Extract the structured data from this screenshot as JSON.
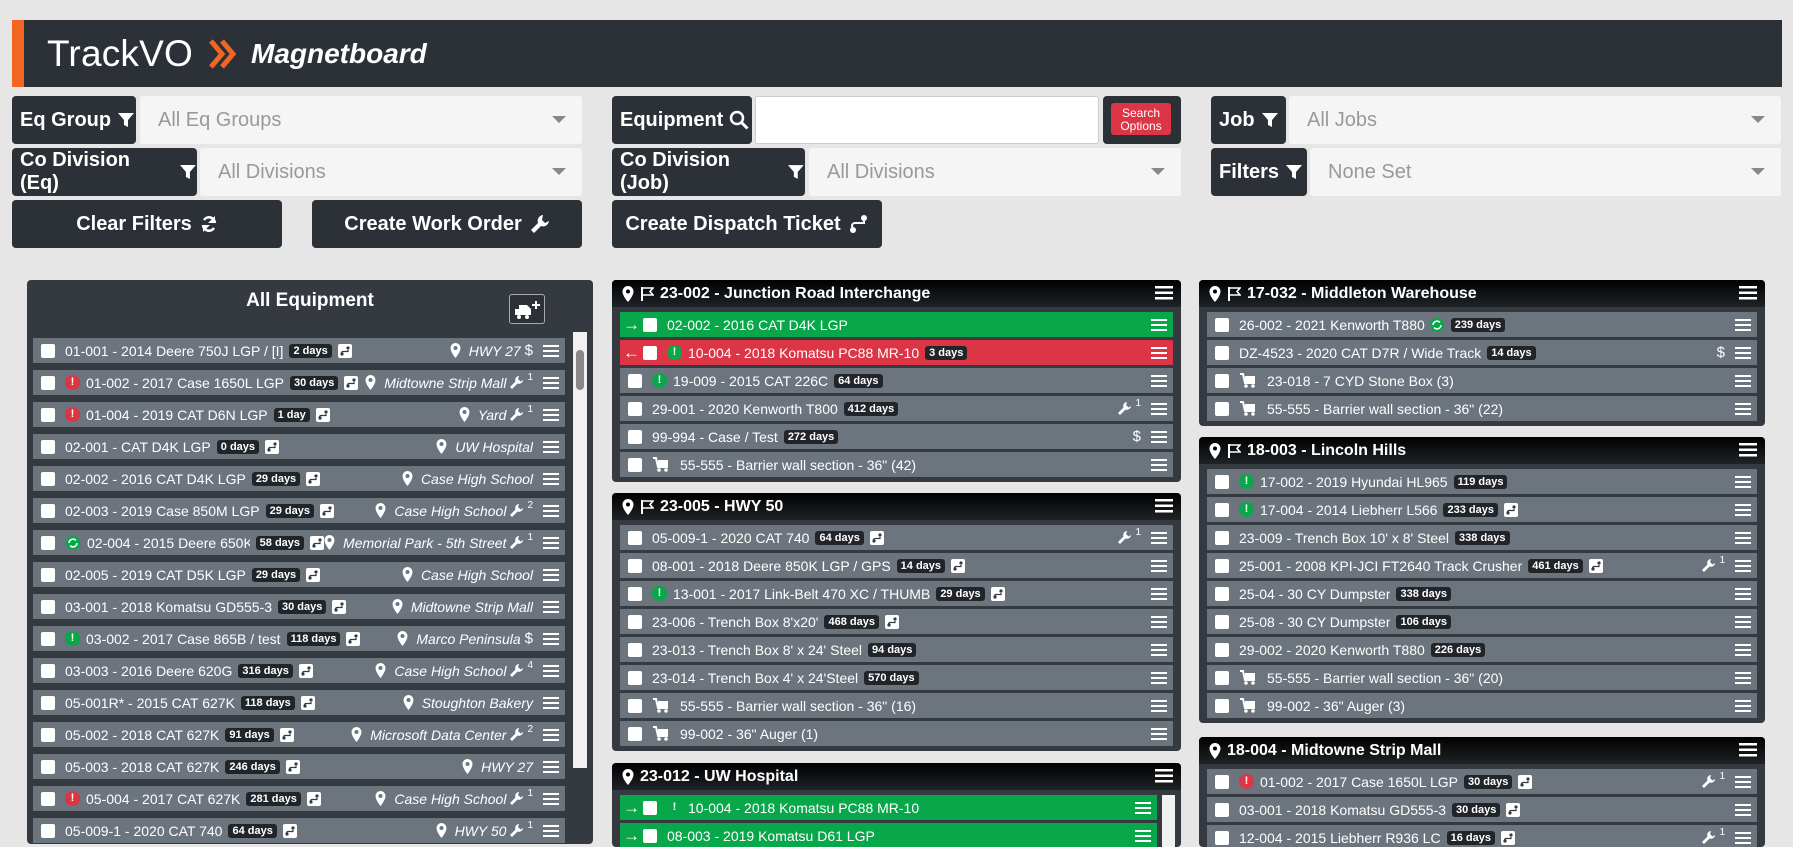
{
  "header": {
    "brand": "TrackVO",
    "subtitle": "Magnetboard"
  },
  "filters": {
    "eq_group_label": "Eq Group",
    "eq_group_value": "All Eq Groups",
    "equipment_label": "Equipment",
    "equipment_value": "",
    "search_options": "Search Options",
    "search_options_1": "Search",
    "search_options_2": "Options",
    "job_label": "Job",
    "job_value": "All Jobs",
    "co_div_eq_label": "Co Division (Eq)",
    "co_div_eq_value": "All Divisions",
    "co_div_job_label": "Co Division (Job)",
    "co_div_job_value": "All Divisions",
    "filters_label": "Filters",
    "filters_value": "None Set"
  },
  "actions": {
    "clear": "Clear Filters",
    "work_order": "Create Work Order",
    "dispatch": "Create Dispatch Ticket"
  },
  "all_equipment": {
    "title": "All Equipment",
    "rows": [
      {
        "label": "01-001 - 2014 Deere 750J LGP / [I]",
        "days": "2 days",
        "loc": "HWY 27",
        "dollar": true,
        "wrench": null,
        "alert": null
      },
      {
        "label": "01-002 - 2017 Case 1650L LGP",
        "days": "30 days",
        "loc": "Midtowne Strip Mall",
        "dollar": false,
        "wrench": "1",
        "alert": "red"
      },
      {
        "label": "01-004 - 2019 CAT D6N LGP",
        "days": "1 day",
        "loc": "Yard",
        "dollar": false,
        "wrench": "1",
        "alert": "red"
      },
      {
        "label": "02-001 - CAT D4K LGP",
        "days": "0 days",
        "loc": "UW Hospital",
        "dollar": false,
        "wrench": null,
        "alert": null
      },
      {
        "label": "02-002 - 2016 CAT D4K LGP",
        "days": "29 days",
        "loc": "Case High School",
        "dollar": false,
        "wrench": null,
        "alert": null
      },
      {
        "label": "02-003 - 2019 Case 850M LGP",
        "days": "29 days",
        "loc": "Case High School",
        "dollar": false,
        "wrench": "2",
        "alert": null
      },
      {
        "label": "02-004 - 2015 Deere 650K",
        "days": "58 days",
        "loc": "Memorial Park - 5th Street",
        "dollar": false,
        "wrench": "1",
        "alert": "sync"
      },
      {
        "label": "02-005 - 2019 CAT D5K LGP",
        "days": "29 days",
        "loc": "Case High School",
        "dollar": false,
        "wrench": null,
        "alert": null
      },
      {
        "label": "03-001 - 2018 Komatsu GD555-3",
        "days": "30 days",
        "loc": "Midtowne Strip Mall",
        "dollar": false,
        "wrench": null,
        "alert": null
      },
      {
        "label": "03-002 - 2017 Case 865B / test",
        "days": "118 days",
        "loc": "Marco Peninsula",
        "dollar": true,
        "wrench": null,
        "alert": "green"
      },
      {
        "label": "03-003 - 2016 Deere 620G",
        "days": "316 days",
        "loc": "Case High School",
        "dollar": false,
        "wrench": "4",
        "alert": null
      },
      {
        "label": "05-001R* - 2015 CAT 627K",
        "days": "118 days",
        "loc": "Stoughton Bakery",
        "dollar": false,
        "wrench": null,
        "alert": null
      },
      {
        "label": "05-002 - 2018 CAT 627K",
        "days": "91 days",
        "loc": "Microsoft Data Center",
        "dollar": false,
        "wrench": "2",
        "alert": null
      },
      {
        "label": "05-003 - 2018 CAT 627K",
        "days": "246 days",
        "loc": "HWY 27",
        "dollar": false,
        "wrench": null,
        "alert": null
      },
      {
        "label": "05-004 - 2017 CAT 627K",
        "days": "281 days",
        "loc": "Case High School",
        "dollar": false,
        "wrench": "1",
        "alert": "red"
      },
      {
        "label": "05-009-1 - 2020 CAT 740",
        "days": "64 days",
        "loc": "HWY 50",
        "dollar": false,
        "wrench": "1",
        "alert": null
      }
    ]
  },
  "jobs": [
    {
      "title": "23-002 - Junction Road Interchange",
      "flag": true,
      "rows": [
        {
          "label": "02-002 - 2016 CAT D4K LGP",
          "color": "g",
          "arrow": "→"
        },
        {
          "label": "10-004 - 2018 Komatsu PC88 MR-10",
          "days": "3 days",
          "color": "r",
          "arrow": "←",
          "alert": "green"
        },
        {
          "label": "19-009 - 2015 CAT 226C",
          "days": "64 days",
          "alert": "green"
        },
        {
          "label": "29-001 - 2020 Kenworth T800",
          "days": "412 days",
          "wrench": "1"
        },
        {
          "label": "99-994 - Case / Test",
          "days": "272 days",
          "dollar": true
        },
        {
          "label": "55-555 - Barrier wall section - 36\" (42)",
          "cart": true
        }
      ]
    },
    {
      "title": "23-005 - HWY 50",
      "flag": true,
      "rows": [
        {
          "label": "05-009-1 - 2020 CAT 740",
          "days": "64 days",
          "dispatch": true,
          "wrench": "1"
        },
        {
          "label": "08-001 - 2018 Deere 850K LGP / GPS",
          "days": "14 days",
          "dispatch": true
        },
        {
          "label": "13-001 - 2017 Link-Belt 470 XC / THUMB",
          "days": "29 days",
          "dispatch": true,
          "alert": "green"
        },
        {
          "label": "23-006 - Trench Box 8'x20'",
          "days": "468 days",
          "dispatch": true
        },
        {
          "label": "23-013 - Trench Box 8' x 24' Steel",
          "days": "94 days"
        },
        {
          "label": "23-014 - Trench Box 4' x 24'Steel",
          "days": "570 days"
        },
        {
          "label": "55-555 - Barrier wall section - 36\" (16)",
          "cart": true
        },
        {
          "label": "99-002 - 36\" Auger (1)",
          "cart": true
        }
      ]
    },
    {
      "title": "23-012 - UW Hospital",
      "flag": false,
      "rows": [
        {
          "label": "10-004 - 2018 Komatsu PC88 MR-10",
          "color": "g",
          "arrow": "→",
          "alert": "green"
        },
        {
          "label": "08-003 - 2019 Komatsu D61 LGP",
          "color": "g",
          "arrow": "→"
        }
      ]
    },
    {
      "title": "17-032 - Middleton Warehouse",
      "flag": true,
      "rows": [
        {
          "label": "26-002 - 2021 Kenworth T880",
          "days": "239 days",
          "alert": "sync"
        },
        {
          "label": "DZ-4523 - 2020 CAT D7R / Wide Track",
          "days": "14 days",
          "dollar": true
        },
        {
          "label": "23-018 - 7 CYD Stone Box (3)",
          "cart": true
        },
        {
          "label": "55-555 - Barrier wall section - 36\" (22)",
          "cart": true
        }
      ]
    },
    {
      "title": "18-003 - Lincoln Hills",
      "flag": true,
      "rows": [
        {
          "label": "17-002 - 2019 Hyundai HL965",
          "days": "119 days",
          "alert": "green"
        },
        {
          "label": "17-004 - 2014 Liebherr L566",
          "days": "233 days",
          "dispatch": true,
          "alert": "green"
        },
        {
          "label": "23-009 - Trench Box 10' x 8' Steel",
          "days": "338 days"
        },
        {
          "label": "25-001 - 2008 KPI-JCI FT2640 Track Crusher",
          "days": "461 days",
          "dispatch": true,
          "wrench": "1"
        },
        {
          "label": "25-04 - 30 CY Dumpster",
          "days": "338 days"
        },
        {
          "label": "25-08 - 30 CY Dumpster",
          "days": "106 days"
        },
        {
          "label": "29-002 - 2020 Kenworth T880",
          "days": "226 days"
        },
        {
          "label": "55-555 - Barrier wall section - 36\" (20)",
          "cart": true
        },
        {
          "label": "99-002 - 36\" Auger (3)",
          "cart": true
        }
      ]
    },
    {
      "title": "18-004 - Midtowne Strip Mall",
      "flag": false,
      "rows": [
        {
          "label": "01-002 - 2017 Case 1650L LGP",
          "days": "30 days",
          "dispatch": true,
          "wrench": "1",
          "alert": "red"
        },
        {
          "label": "03-001 - 2018 Komatsu GD555-3",
          "days": "30 days",
          "dispatch": true
        },
        {
          "label": "12-004 - 2015 Liebherr R936 LC",
          "days": "16 days",
          "dispatch": true,
          "wrench": "1"
        }
      ]
    }
  ],
  "colors": {
    "accent": "#f26522",
    "dark": "#2c3138",
    "row": "#6c757d",
    "green": "#08a84a",
    "red": "#dc3545"
  }
}
